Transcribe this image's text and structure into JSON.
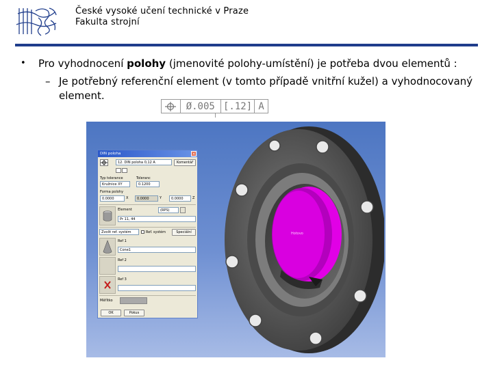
{
  "header": {
    "institution": "České vysoké učení technické v Praze",
    "faculty": "Fakulta strojní",
    "rule_color": "#1f3d8c"
  },
  "content": {
    "bullet_symbol": "•",
    "line1_pre": "Pro vyhodnocení ",
    "line1_bold": "polohy",
    "line1_post": " (jmenovité polohy-umístění) je potřeba dvou elementů :",
    "sub_dash": "–",
    "sub_line1": "Je potřebný referenční element (v tomto případě  vnitřní kužel) a vyhodnocovaný",
    "sub_line2": "element."
  },
  "feature_control_frame": {
    "symbol_icon": "position-crosshair-icon",
    "diameter_symbol": "Ø",
    "tolerance": ".005",
    "modifier": "[.12]",
    "datum": "A"
  },
  "dialog": {
    "title": "DIN poloha",
    "name_value": "12. DIN poloha 0,12 A",
    "comment_button": "Komentář",
    "tolerance_type_label": "Typ tolerance",
    "tolerance_label": "Toleranc",
    "tolerance_type_value": "Kružnice XY",
    "tolerance_value": "0.1200",
    "form_label": "Forma polohy",
    "x_value": "0.0000",
    "x_axis": "X",
    "y_value": "0.0000",
    "y_axis": "Y",
    "z_value": "0.0000",
    "z_axis": "Z",
    "element_label": "Element",
    "element_select": "(RPS)",
    "element_value": "Pr 11, 44",
    "coord_label": "Zvolit ref. systém",
    "ref_system_checkbox": "Ref. systém",
    "special_button": "Speciální",
    "ref1_label": "Ref 1",
    "ref1_value": "Cone1",
    "ref2_label": "Ref 2",
    "ref3_label": "Ref 3",
    "measure_label": "Měřítko",
    "ok_button": "OK",
    "cancel_button": "Pokus",
    "title_color": "#2a58c9",
    "face_color": "#ece9d8"
  },
  "model": {
    "annotation": "Hotovo",
    "part_color": "#5e5e5e",
    "highlight_color": "#e100e6",
    "background_color": "#4d76c2"
  }
}
